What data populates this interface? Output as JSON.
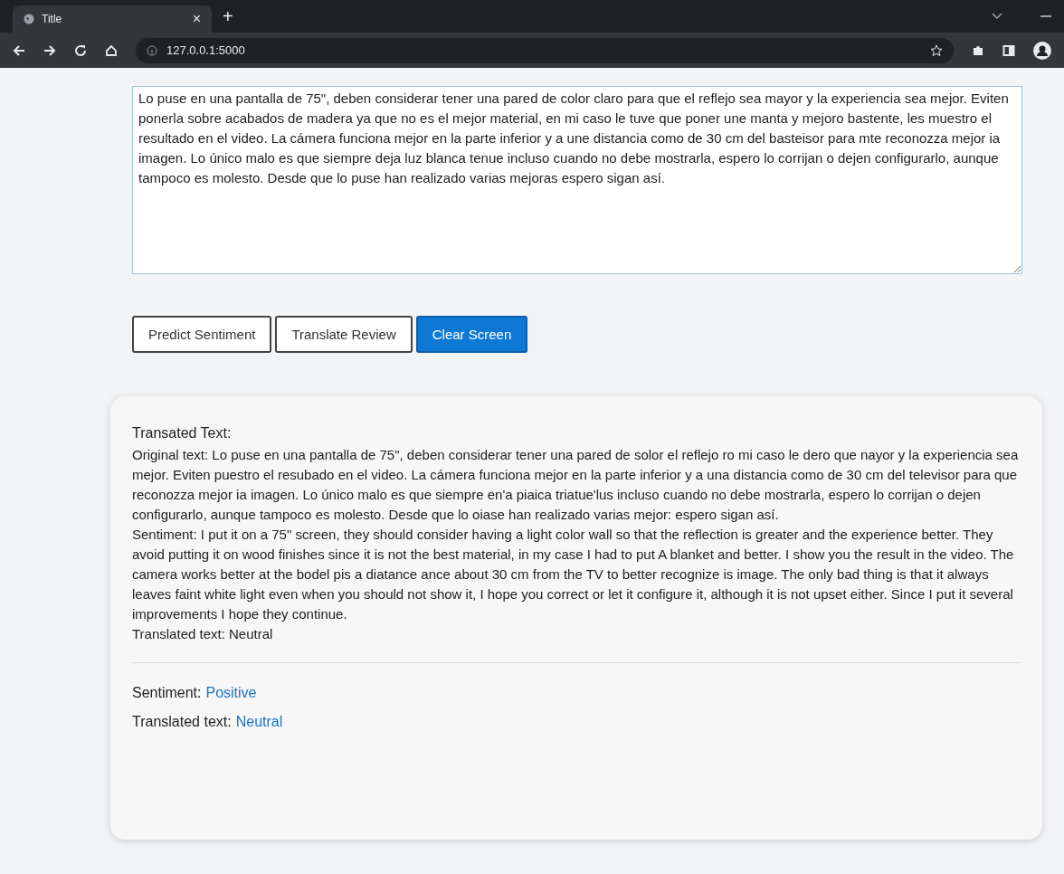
{
  "browser": {
    "tab_title": "Title",
    "tab_close": "×",
    "new_tab": "+",
    "url": "127.0.0.1:5000"
  },
  "review_field": {
    "value": "Lo puse en una pantalla de 75\", deben considerar tener una pared de color claro para que el reflejo sea mayor y la experiencia sea mejor. Eviten ponerla sobre acabados de madera ya que no es el mejor material, en mi caso le tuve que poner une manta y mejoro bastente, les muestro el resultado en el video. La cámera funciona mejor en la parte inferior y a une distancia como de 30 cm del basteisor para mte reconozza mejor ia imagen. Lo único malo es que siempre deja luz blanca tenue incluso cuando no debe mostrarla, espero lo corrijan o dejen configurarlo, aunque tampoco es molesto. Desde que lo puse han realizado varias mejoras espero sigan así."
  },
  "buttons": [
    {
      "label": "Predict Sentiment",
      "kind": "outline"
    },
    {
      "label": "Translate Review",
      "kind": "outline"
    },
    {
      "label": "Clear Screen",
      "kind": "primary"
    }
  ],
  "result": {
    "heading": "Transated Text:",
    "lines": [
      "Original text: Lo puse en una pantalla de 75\", deben considerar tener una pared de solor el reflejo ro mi caso le dero que nayor y la experiencia sea mejor. Eviten puestro el resubado en el video. La cámera funciona mejor en la parte inferior y a una distancia como de 30 cm del televisor para que reconozza mejor ia imagen. Lo único malo es que siempre en'a piaica triatue'lus incluso cuando no debe mostrarla, espero lo corrijan o dejen configurarlo, aunque tampoco es molesto. Desde que lo oiase han realizado varias mejor: espero sigan así.",
      "Sentiment: I put it on a 75\" screen, they should consider having a light color wall so that the reflection is greater and the experience better. They avoid putting it on wood finishes since it is not the best material, in my case I had to put A blanket and better. I show you the result in the video. The camera works better at the bodel pis a diatance ance about 30 cm from the TV to better recognize is image. The only bad thing is that it always leaves faint white light even when you should not show it, I hope you correct or let it configure it, although it is not upset either. Since I put it several improvements I hope they continue.",
      "Translated text: Neutral"
    ],
    "summary": [
      {
        "label": "Sentiment:",
        "value": "Positive"
      },
      {
        "label": "Translated text:",
        "value": "Neutral"
      }
    ]
  }
}
